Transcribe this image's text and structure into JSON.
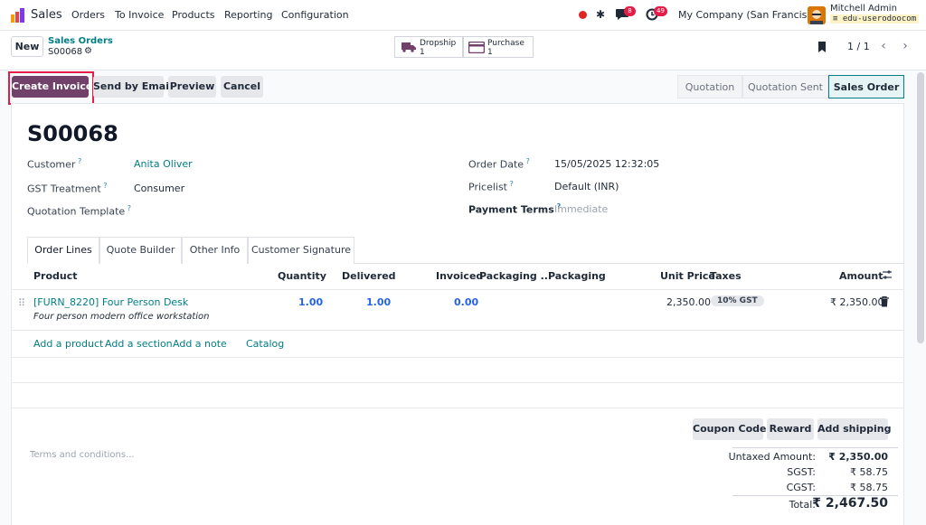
{
  "nav": {
    "app_name": "Sales",
    "items": [
      "Orders",
      "To Invoice",
      "Products",
      "Reporting",
      "Configuration"
    ],
    "chat_badge": "8",
    "activity_badge": "49",
    "company": "My Company (San Francisco)",
    "user_name": "Mitchell Admin",
    "db_name": "edu-userodoocom"
  },
  "control": {
    "new_label": "New",
    "breadcrumb_parent": "Sales Orders",
    "record_name": "S00068",
    "smart_buttons": [
      {
        "label": "Dropship",
        "count": "1"
      },
      {
        "label": "Purchase",
        "count": "1"
      }
    ],
    "pager": "1 / 1"
  },
  "actions": {
    "create_invoice": "Create Invoice",
    "send_by_email": "Send by Email",
    "preview": "Preview",
    "cancel": "Cancel"
  },
  "statusbar": [
    "Quotation",
    "Quotation Sent",
    "Sales Order"
  ],
  "statusbar_active": "Sales Order",
  "form": {
    "title": "S00068",
    "customer_label": "Customer",
    "customer_value": "Anita Oliver",
    "gst_label": "GST Treatment",
    "gst_value": "Consumer",
    "template_label": "Quotation Template",
    "template_value": "",
    "order_date_label": "Order Date",
    "order_date_value": "15/05/2025 12:32:05",
    "pricelist_label": "Pricelist",
    "pricelist_value": "Default (INR)",
    "payment_terms_label": "Payment Terms",
    "payment_terms_value": "Immediate"
  },
  "tabs": [
    "Order Lines",
    "Quote Builder",
    "Other Info",
    "Customer Signature"
  ],
  "table": {
    "headers": [
      "Product",
      "Quantity",
      "Delivered",
      "Invoiced",
      "Packaging ...",
      "Packaging",
      "Unit Price",
      "Taxes",
      "Amount"
    ],
    "rows": [
      {
        "product": "[FURN_8220] Four Person Desk",
        "description": "Four person modern office workstation",
        "quantity": "1.00",
        "delivered": "1.00",
        "invoiced": "0.00",
        "unit_price": "2,350.00",
        "tax": "10% GST",
        "amount": "₹ 2,350.00"
      }
    ],
    "add_product": "Add a product",
    "add_section": "Add a section",
    "add_note": "Add a note",
    "catalog": "Catalog"
  },
  "footer": {
    "terms_placeholder": "Terms and conditions...",
    "coupon_code": "Coupon Code",
    "reward": "Reward",
    "add_shipping": "Add shipping",
    "untaxed_label": "Untaxed Amount:",
    "untaxed_value": "₹ 2,350.00",
    "sgst_label": "SGST:",
    "sgst_value": "₹ 58.75",
    "cgst_label": "CGST:",
    "cgst_value": "₹ 58.75",
    "total_label": "Total:",
    "total_value": "₹ 2,467.50"
  },
  "colors": {
    "primary": "#71416a",
    "link": "#017e84",
    "highlight": "#e11d48",
    "status_active_bg": "#e6f4f5"
  }
}
